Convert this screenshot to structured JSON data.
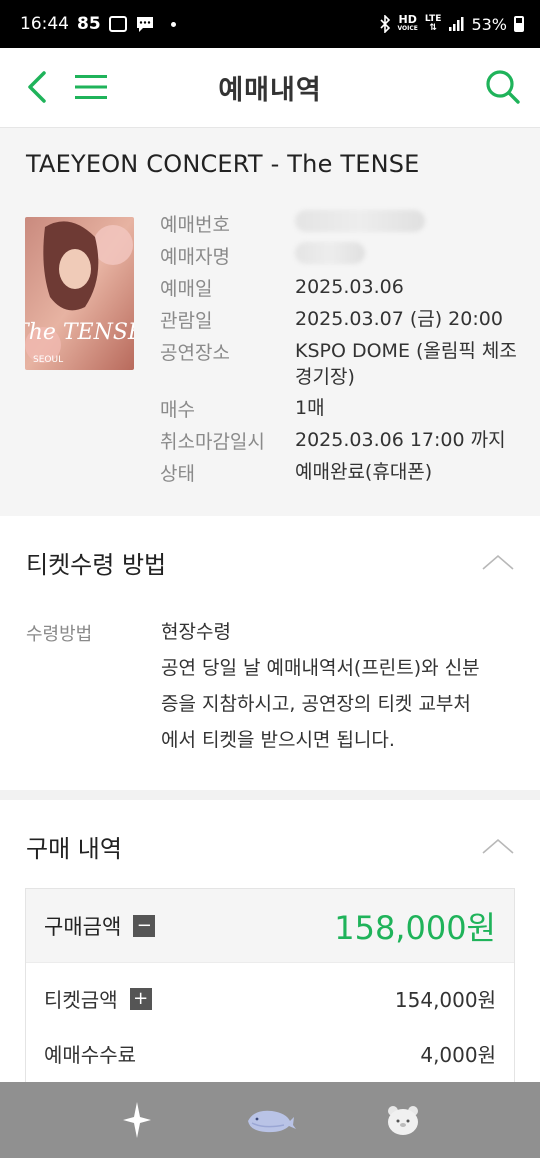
{
  "status_bar": {
    "time": "16:44",
    "notif_count": "85",
    "hd_label": "HD",
    "voice_label": "VOICE",
    "lte_label": "LTE",
    "battery": "53%"
  },
  "header": {
    "title": "예매내역"
  },
  "concert": {
    "title": "TAEYEON CONCERT - The TENSE",
    "poster": {
      "title_text": "The TENSE",
      "city": "SEOUL"
    },
    "fields": [
      {
        "label": "예매번호",
        "value": ""
      },
      {
        "label": "예매자명",
        "value": ""
      },
      {
        "label": "예매일",
        "value": "2025.03.06"
      },
      {
        "label": "관람일",
        "value": "2025.03.07 (금) 20:00"
      },
      {
        "label": "공연장소",
        "value": "KSPO DOME (올림픽 체조\n경기장)"
      },
      {
        "label": "매수",
        "value": "1매"
      },
      {
        "label": "취소마감일시",
        "value": "2025.03.06 17:00 까지"
      },
      {
        "label": "상태",
        "value": "예매완료(휴대폰)"
      }
    ]
  },
  "ticket_section": {
    "title": "티켓수령 방법",
    "method_label": "수령방법",
    "method_name": "현장수령",
    "method_desc_1": "공연 당일 날 예매내역서(프린트)와 신분",
    "method_desc_2": "증을 지참하시고, 공연장의 티켓 교부처",
    "method_desc_3": "에서 티켓을 받으시면 됩니다."
  },
  "purchase_section": {
    "title": "구매 내역",
    "total_label": "구매금액",
    "total_value": "158,000원",
    "rows": [
      {
        "label": "티켓금액",
        "value": "154,000원",
        "toggle": "+"
      },
      {
        "label": "예매수수료",
        "value": "4,000원"
      }
    ],
    "total_toggle": "−"
  },
  "colors": {
    "accent": "#1fb35a",
    "nav_bg": "#909090"
  },
  "bottom_nav": {
    "items": [
      "sparkle-icon",
      "whale-icon",
      "bear-icon"
    ]
  }
}
